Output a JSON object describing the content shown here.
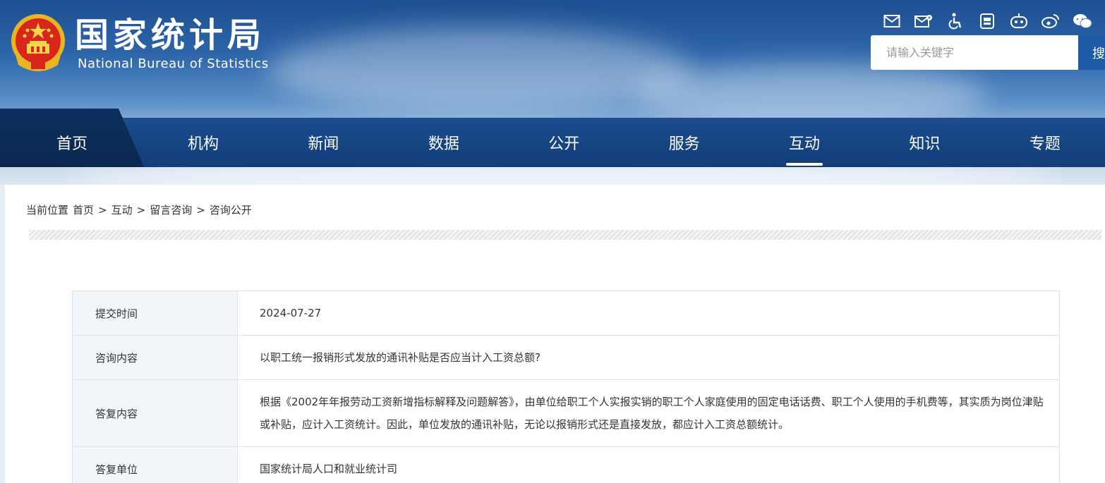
{
  "header": {
    "title": "国家统计局",
    "subtitle": "National Bureau of Statistics",
    "tools": [
      {
        "icon": "mail-icon"
      },
      {
        "icon": "mail-settings-icon"
      },
      {
        "icon": "accessibility-icon"
      },
      {
        "icon": "app-icon"
      },
      {
        "icon": "robot-icon"
      },
      {
        "icon": "weibo-icon"
      },
      {
        "icon": "wechat-icon"
      }
    ],
    "search": {
      "placeholder": "请输入关键字",
      "button": "搜"
    }
  },
  "nav": {
    "items": [
      {
        "label": "首页"
      },
      {
        "label": "机构"
      },
      {
        "label": "新闻"
      },
      {
        "label": "数据"
      },
      {
        "label": "公开"
      },
      {
        "label": "服务"
      },
      {
        "label": "互动",
        "active": true
      },
      {
        "label": "知识"
      },
      {
        "label": "专题"
      }
    ]
  },
  "breadcrumb": {
    "prefix": "当前位置",
    "items": [
      "首页",
      "互动",
      "留言咨询",
      "咨询公开"
    ],
    "separator": ">"
  },
  "record": {
    "rows": [
      {
        "label": "提交时间",
        "value": "2024-07-27"
      },
      {
        "label": "咨询内容",
        "value": "以职工统一报销形式发放的通讯补贴是否应当计入工资总额?"
      },
      {
        "label": "答复内容",
        "value": "根据《2002年年报劳动工资新增指标解释及问题解答》，由单位给职工个人实报实销的职工个人家庭使用的固定电话话费、职工个人使用的手机费等，其实质为岗位津贴或补贴，应计入工资统计。因此，单位发放的通讯补贴，无论以报销形式还是直接发放，都应计入工资总额统计。"
      },
      {
        "label": "答复单位",
        "value": "国家统计局人口和就业统计司"
      }
    ]
  },
  "colors": {
    "nav_bg": "#123d78",
    "nav_home_bg": "#0a2850",
    "search_button": "#1f5aa6",
    "label_cell_bg": "#f2f6fb"
  }
}
